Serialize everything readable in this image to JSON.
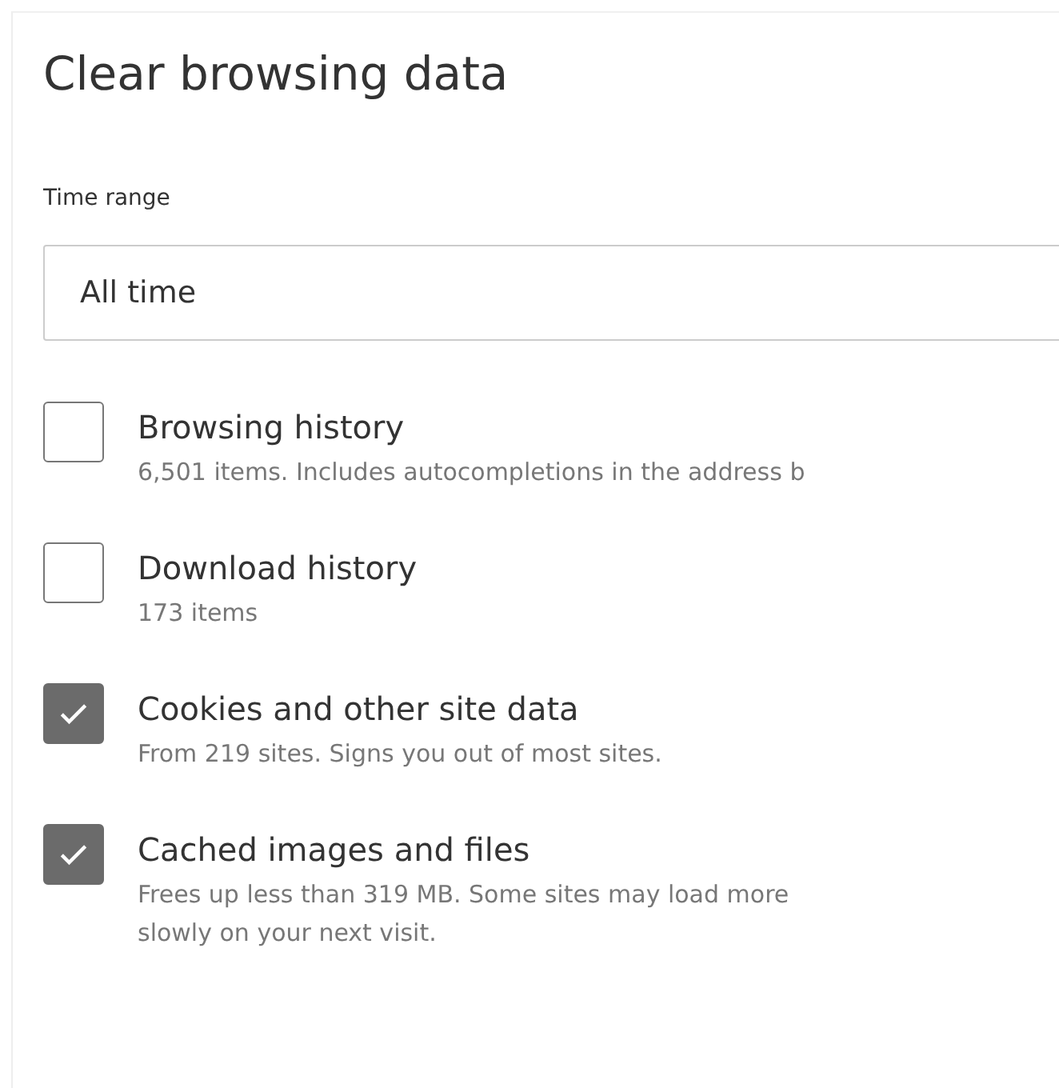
{
  "title": "Clear browsing data",
  "time_range": {
    "label": "Time range",
    "value": "All time"
  },
  "options": [
    {
      "label": "Browsing history",
      "description": "6,501 items. Includes autocompletions in the address b",
      "checked": false
    },
    {
      "label": "Download history",
      "description": "173 items",
      "checked": false
    },
    {
      "label": "Cookies and other site data",
      "description": "From 219 sites. Signs you out of most sites.",
      "checked": true
    },
    {
      "label": "Cached images and files",
      "description": "Frees up less than 319 MB. Some sites may load more slowly on your next visit.",
      "checked": true
    }
  ]
}
